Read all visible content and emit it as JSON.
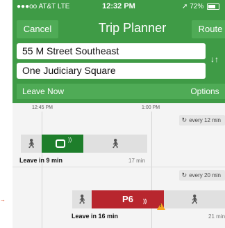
{
  "status_bar": {
    "carrier": "●●●oo AT&T  LTE",
    "time": "12:32 PM",
    "battery": "72%",
    "battery_level": 0.72
  },
  "nav": {
    "cancel_label": "Cancel",
    "title": "Trip Planner",
    "route_label": "Route"
  },
  "form": {
    "from": "55 M Street Southeast",
    "to": "One Judiciary Square",
    "swap_icon": "↓↑",
    "leave_now_label": "Leave Now",
    "options_label": "Options"
  },
  "timeline": {
    "ticks": [
      "12:45 PM",
      "1:00 PM"
    ]
  },
  "trips": [
    {
      "frequency": "every 12 min",
      "leave": "Leave in 9 min",
      "duration": "17 min",
      "mode_icon": "bus-icon",
      "route": ""
    },
    {
      "frequency": "every 20 min",
      "leave": "Leave in 16 min",
      "duration": "21 min",
      "mode_icon": "bus-icon",
      "route": "P6",
      "alert_icon": "warning-icon"
    }
  ],
  "colors": {
    "header": "#3f9b46",
    "button": "#4fab56",
    "route_green": "#1e7e2b",
    "route_red": "#b8262e",
    "warning": "#f5a623"
  }
}
